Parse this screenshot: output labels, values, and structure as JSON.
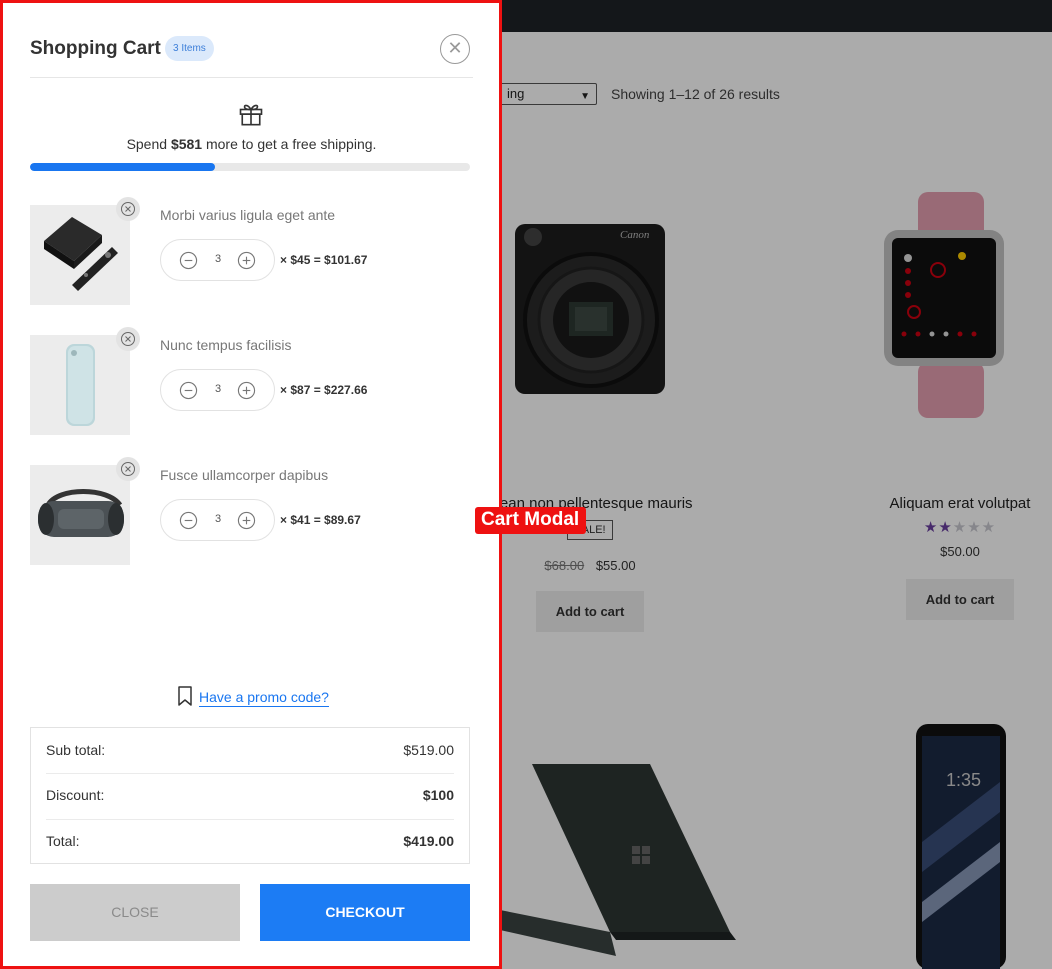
{
  "shop": {
    "sort_visible": "ing",
    "results_text": "Showing 1–12 of 26 results",
    "products": [
      {
        "name": "...ean non pellentesque mauris",
        "sale_badge": "SALE!",
        "old_price": "$68.00",
        "price": "$55.00",
        "add_to_cart": "Add to cart",
        "image": "camera"
      },
      {
        "name": "Aliquam erat volutpat",
        "rating_stars": 2,
        "rating_max": 5,
        "price": "$50.00",
        "add_to_cart": "Add to cart",
        "image": "smartwatch"
      },
      {
        "image": "laptop"
      },
      {
        "image": "foldable-phone"
      }
    ]
  },
  "cart": {
    "title": "Shopping Cart",
    "count_badge": "3 Items",
    "close_icon": "close-icon",
    "shipping": {
      "prefix": "Spend ",
      "amount": "$581",
      "suffix": " more to get a free shipping.",
      "progress_fraction": 0.42
    },
    "items": [
      {
        "name": "Morbi varius ligula eget ante",
        "qty": "3",
        "calc": "× $45 = $101.67",
        "image": "apple-tv"
      },
      {
        "name": "Nunc tempus facilisis",
        "qty": "3",
        "calc": "× $87 = $227.66",
        "image": "iphone-case"
      },
      {
        "name": "Fusce ullamcorper dapibus",
        "qty": "3",
        "calc": "× $41 = $89.67",
        "image": "speaker"
      }
    ],
    "promo_link": "Have a promo code?",
    "summary": {
      "subtotal_label": "Sub total:",
      "subtotal_value": "$519.00",
      "discount_label": "Discount:",
      "discount_value": "$100",
      "total_label": "Total:",
      "total_value": "$419.00"
    },
    "buttons": {
      "close": "CLOSE",
      "checkout": "CHECKOUT"
    }
  },
  "annotation": {
    "label": "Cart Modal",
    "color": "#ee1111"
  },
  "colors": {
    "accent": "#1976f0",
    "checkout": "#1c7cf4",
    "annotation": "#ee1111"
  }
}
